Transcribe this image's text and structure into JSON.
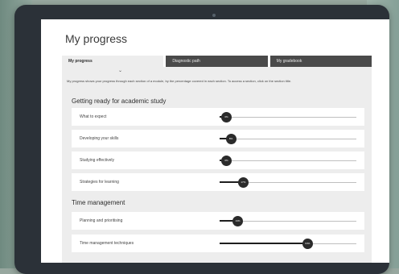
{
  "page": {
    "title": "My progress"
  },
  "tabs": [
    {
      "label": "My progress",
      "active": true
    },
    {
      "label": "Diagnostic path",
      "active": false
    },
    {
      "label": "My gradebook",
      "active": false
    }
  ],
  "intro_text": "My progress shows your progress through each section of a module, by the percentage covered in each section. To access a section, click on the section title.",
  "sections": [
    {
      "heading": "Getting ready for academic study",
      "items": [
        {
          "label": "What to expect",
          "percent": 0,
          "badge": "0%"
        },
        {
          "label": "Developing your skills",
          "percent": 8,
          "badge": "8%"
        },
        {
          "label": "Studying effectively",
          "percent": 0,
          "badge": "0%"
        },
        {
          "label": "Strategies for learning",
          "percent": 17,
          "badge": "17%"
        }
      ]
    },
    {
      "heading": "Time management",
      "items": [
        {
          "label": "Planning and prioritising",
          "percent": 13,
          "badge": "13%"
        },
        {
          "label": "Time management techniques",
          "percent": 64,
          "badge": "64%"
        }
      ]
    }
  ],
  "colors": {
    "screen_bg": "#ffffff",
    "panel_bg": "#ededed",
    "tab_dark": "#4a4a4a",
    "knob": "#2b2b2b",
    "device": "#2b3138"
  }
}
